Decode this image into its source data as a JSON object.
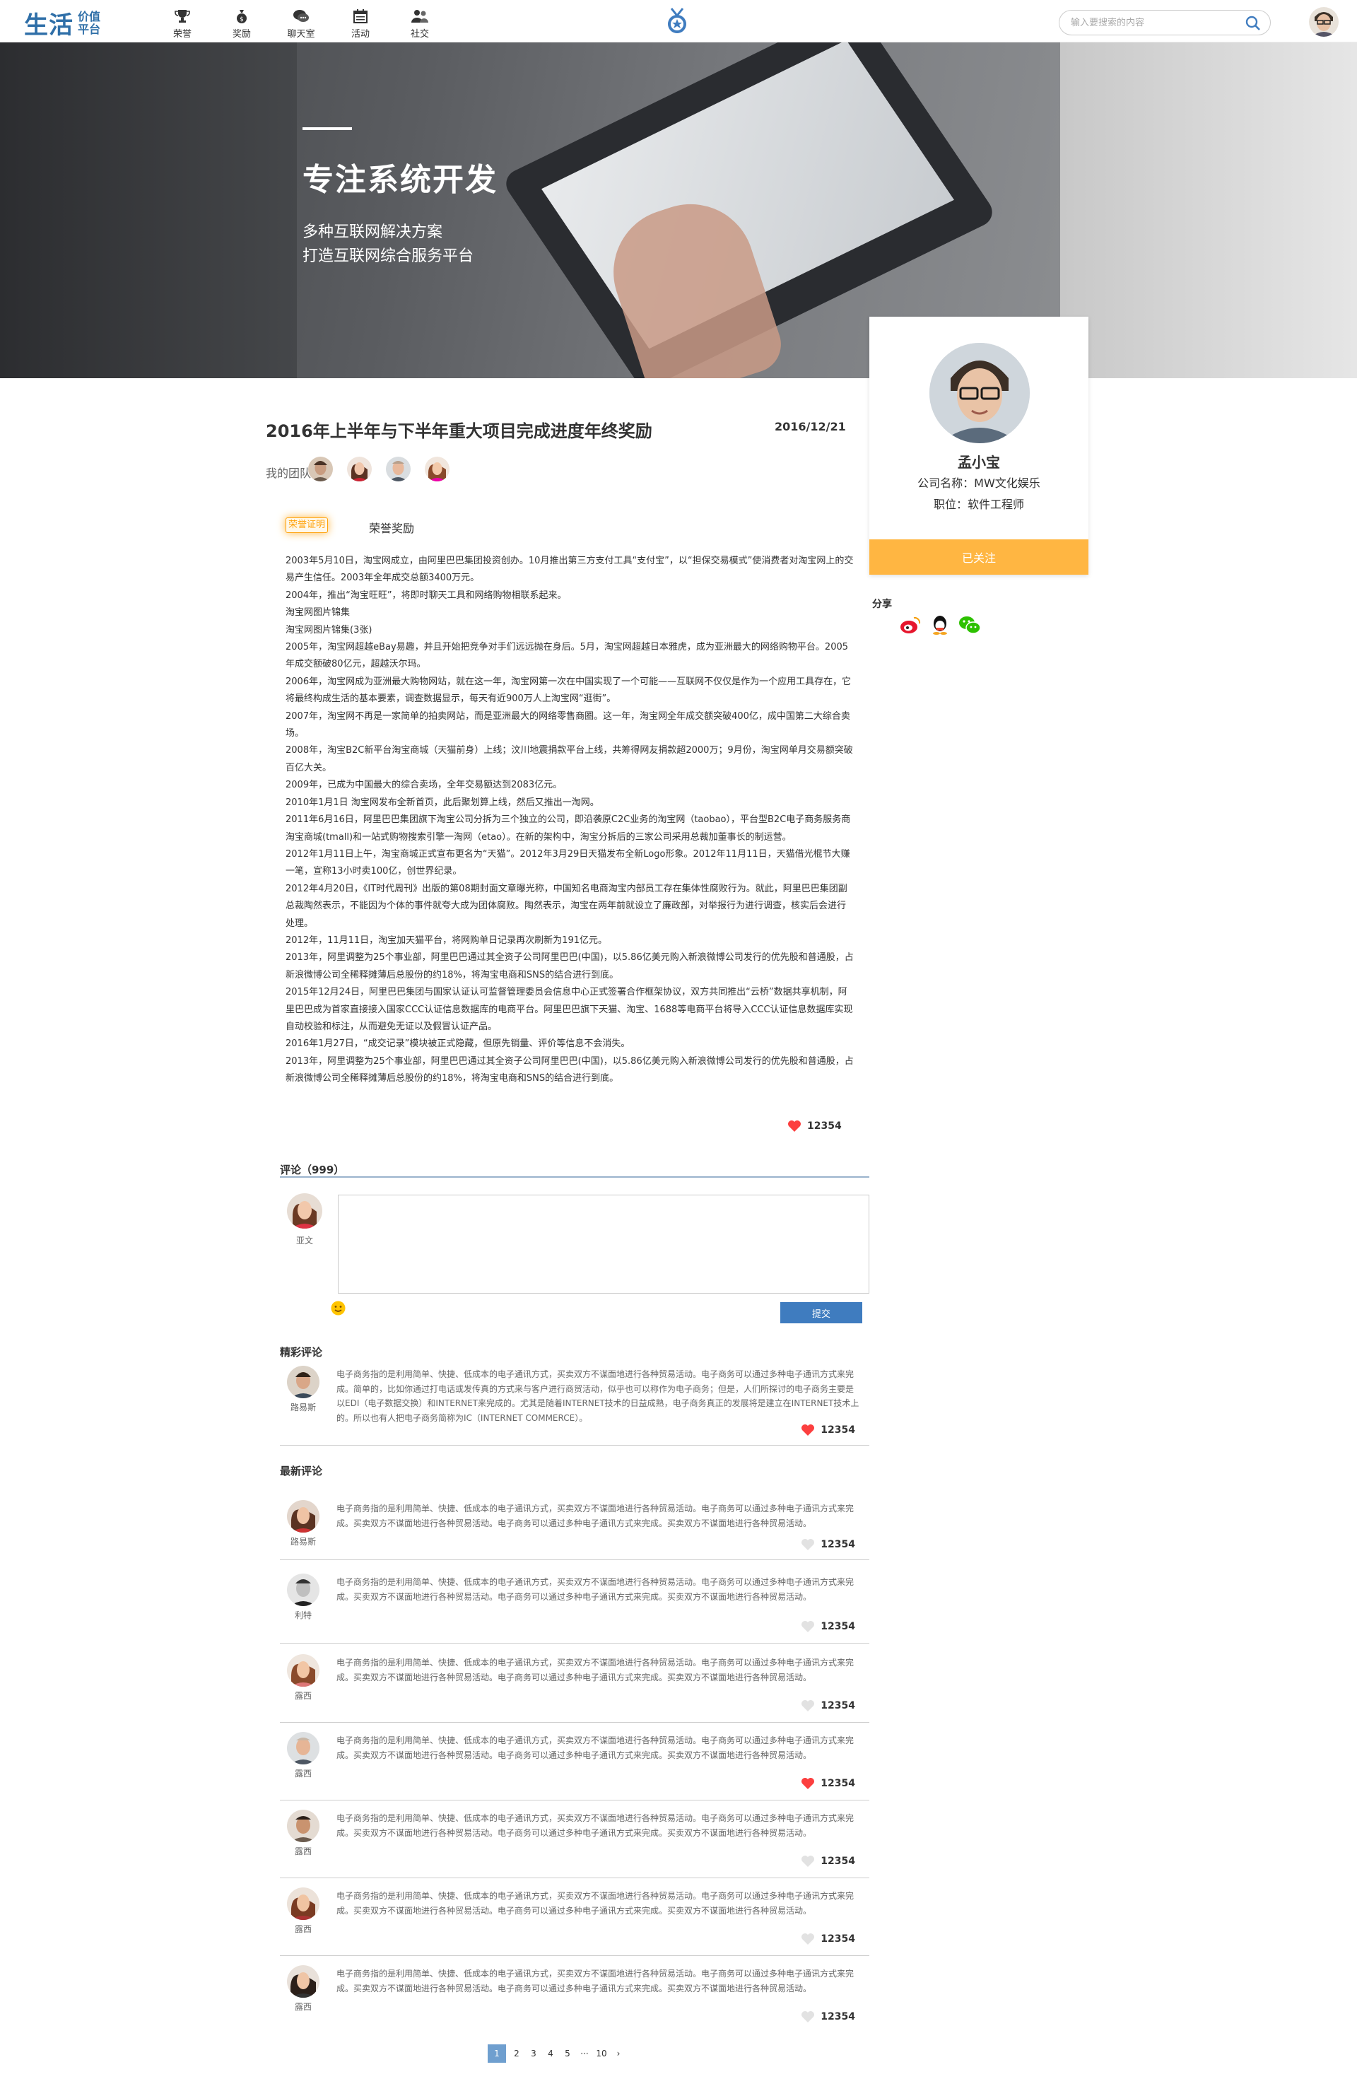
{
  "logo": {
    "big": "生活",
    "small1": "价值",
    "small2": "平台"
  },
  "nav": [
    {
      "label": "荣誉",
      "icon": "trophy-icon"
    },
    {
      "label": "奖励",
      "icon": "money-bag-icon"
    },
    {
      "label": "聊天室",
      "icon": "chat-icon"
    },
    {
      "label": "活动",
      "icon": "calendar-icon"
    },
    {
      "label": "社交",
      "icon": "people-icon"
    }
  ],
  "search": {
    "placeholder": "输入要搜索的内容"
  },
  "banner": {
    "title": "专注系统开发",
    "sub1": "多种互联网解决方案",
    "sub2": "打造互联网综合服务平台"
  },
  "profile": {
    "name": "孟小宝",
    "company": "公司名称：MW文化娱乐",
    "job": "职位：软件工程师",
    "follow": "已关注",
    "share": "分享"
  },
  "article": {
    "title": "2016年上半年与下半年重大项目完成进度年终奖励",
    "date": "2016/12/21",
    "team_label": "我的团队",
    "award_tag": "荣誉证明",
    "award_text": "荣誉奖励",
    "paragraphs": [
      "2003年5月10日，淘宝网成立，由阿里巴巴集团投资创办。10月推出第三方支付工具“支付宝”，以“担保交易模式”使消费者对淘宝网上的交易产生信任。2003年全年成交总额3400万元。",
      "2004年，推出“淘宝旺旺”，将即时聊天工具和网络购物相联系起来。",
      "淘宝网图片锦集",
      "淘宝网图片锦集(3张)",
      "2005年，淘宝网超越eBay易趣，并且开始把竞争对手们远远抛在身后。5月，淘宝网超越日本雅虎，成为亚洲最大的网络购物平台。2005年成交额破80亿元，超越沃尔玛。",
      "2006年，淘宝网成为亚洲最大购物网站，就在这一年，淘宝网第一次在中国实现了一个可能——互联网不仅仅是作为一个应用工具存在，它将最终构成生活的基本要素，调查数据显示，每天有近900万人上淘宝网“逛街”。",
      "2007年，淘宝网不再是一家简单的拍卖网站，而是亚洲最大的网络零售商圈。这一年，淘宝网全年成交额突破400亿，成中国第二大综合卖场。",
      "2008年，淘宝B2C新平台淘宝商城（天猫前身）上线；汶川地震捐款平台上线，共筹得网友捐款超2000万；9月份，淘宝网单月交易额突破百亿大关。",
      "2009年，已成为中国最大的综合卖场，全年交易额达到2083亿元。",
      "2010年1月1日 淘宝网发布全新首页，此后聚划算上线，然后又推出一淘网。",
      "2011年6月16日，阿里巴巴集团旗下淘宝公司分拆为三个独立的公司，即沿袭原C2C业务的淘宝网（taobao），平台型B2C电子商务服务商淘宝商城(tmall)和一站式购物搜索引擎一淘网（etao）。在新的架构中，淘宝分拆后的三家公司采用总裁加董事长的制运营。",
      "2012年1月11日上午，淘宝商城正式宣布更名为“天猫”。2012年3月29日天猫发布全新Logo形象。2012年11月11日，天猫借光棍节大赚一笔，宣称13小时卖100亿，创世界纪录。",
      "2012年4月20日，《IT时代周刊》出版的第08期封面文章曝光称，中国知名电商淘宝内部员工存在集体性腐败行为。就此，阿里巴巴集团副总裁陶然表示，不能因为个体的事件就夸大成为团体腐败。陶然表示，淘宝在两年前就设立了廉政部，对举报行为进行调查，核实后会进行处理。",
      "2012年，11月11日，淘宝加天猫平台，将网购单日记录再次刷新为191亿元。",
      "2013年，阿里调整为25个事业部，阿里巴巴通过其全资子公司阿里巴巴(中国)，以5.86亿美元购入新浪微博公司发行的优先股和普通股，占新浪微博公司全稀释摊薄后总股份的约18%，将淘宝电商和SNS的结合进行到底。",
      "2015年12月24日，阿里巴巴集团与国家认证认可监督管理委员会信息中心正式签署合作框架协议，双方共同推出“云桥”数据共享机制，阿里巴巴成为首家直接接入国家CCC认证信息数据库的电商平台。阿里巴巴旗下天猫、淘宝、1688等电商平台将导入CCC认证信息数据库实现自动校验和标注，从而避免无证以及假冒认证产品。",
      "2016年1月27日，“成交记录”模块被正式隐藏，但原先销量、评价等信息不会消失。",
      "2013年，阿里调整为25个事业部，阿里巴巴通过其全资子公司阿里巴巴(中国)，以5.86亿美元购入新浪微博公司发行的优先股和普通股，占新浪微博公司全稀释摊薄后总股份的约18%，将淘宝电商和SNS的结合进行到底。"
    ],
    "likes": "12354"
  },
  "comments": {
    "header": "评论（999）",
    "me_name": "亚文",
    "submit": "提交",
    "featured_header": "精彩评论",
    "latest_header": "最新评论",
    "featured": {
      "name": "路易斯",
      "text": "电子商务指的是利用简单、快捷、低成本的电子通讯方式，买卖双方不谋面地进行各种贸易活动。电子商务可以通过多种电子通讯方式来完成。简单的，比如你通过打电话或发传真的方式来与客户进行商贸活动，似乎也可以称作为电子商务；但是，人们所探讨的电子商务主要是以EDI（电子数据交换）和INTERNET来完成的。尤其是随着INTERNET技术的日益成熟，电子商务真正的发展将是建立在INTERNET技术上的。所以也有人把电子商务简称为IC（INTERNET COMMERCE）。",
      "likes": "12354"
    },
    "latest_text": "电子商务指的是利用简单、快捷、低成本的电子通讯方式，买卖双方不谋面地进行各种贸易活动。电子商务可以通过多种电子通讯方式来完成。买卖双方不谋面地进行各种贸易活动。电子商务可以通过多种电子通讯方式来完成。买卖双方不谋面地进行各种贸易活动。",
    "latest": [
      {
        "name": "路易斯",
        "likes": "12354",
        "liked": false
      },
      {
        "name": "利特",
        "likes": "12354",
        "liked": false
      },
      {
        "name": "露西",
        "likes": "12354",
        "liked": false
      },
      {
        "name": "露西",
        "likes": "12354",
        "liked": true
      },
      {
        "name": "露西",
        "likes": "12354",
        "liked": false
      },
      {
        "name": "露西",
        "likes": "12354",
        "liked": false
      },
      {
        "name": "露西",
        "likes": "12354",
        "liked": false
      }
    ]
  },
  "pager": {
    "pages": [
      "1",
      "2",
      "3",
      "4",
      "5",
      "···",
      "10"
    ],
    "next": "›",
    "current": "1"
  },
  "colors": {
    "brand": "#2f6fa8",
    "follow": "#ffb642",
    "award": "#ffa108",
    "like": "#fc3f3f",
    "submit": "#3f7cbf",
    "divider": "#cdcdcd"
  }
}
